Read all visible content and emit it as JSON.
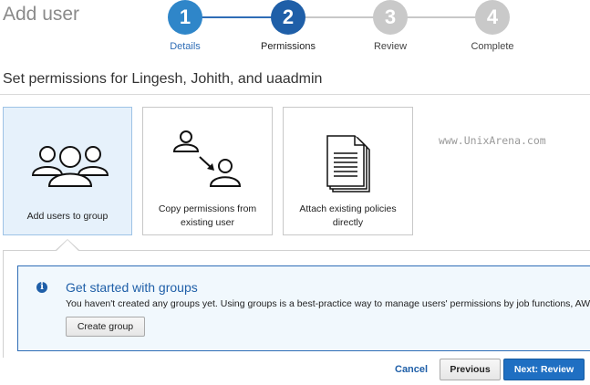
{
  "page": {
    "title": "Add user"
  },
  "stepper": {
    "steps": [
      {
        "number": "1",
        "label": "Details",
        "state": "done"
      },
      {
        "number": "2",
        "label": "Permissions",
        "state": "current"
      },
      {
        "number": "3",
        "label": "Review",
        "state": "todo"
      },
      {
        "number": "4",
        "label": "Complete",
        "state": "todo"
      }
    ]
  },
  "permissions": {
    "heading": "Set permissions for Lingesh, Johith, and uaadmin",
    "options": [
      {
        "label": "Add users to group",
        "icon": "users-group-icon",
        "selected": true
      },
      {
        "label_line1": "Copy permissions from",
        "label_line2": "existing user",
        "icon": "copy-user-permissions-icon",
        "selected": false
      },
      {
        "label_line1": "Attach existing policies",
        "label_line2": "directly",
        "icon": "document-policies-icon",
        "selected": false
      }
    ]
  },
  "watermark": "www.UnixArena.com",
  "info": {
    "icon": "info-icon",
    "title": "Get started with groups",
    "text": "You haven't created any groups yet. Using groups is a best-practice way to manage users' permissions by job functions, AW",
    "create_button": "Create group"
  },
  "footer": {
    "cancel": "Cancel",
    "previous": "Previous",
    "next": "Next: Review"
  },
  "colors": {
    "accent": "#1f5fa8",
    "primary_button": "#1f6fc2",
    "selected_card": "#e6f1fb",
    "step_todo": "#c9c9c9"
  }
}
